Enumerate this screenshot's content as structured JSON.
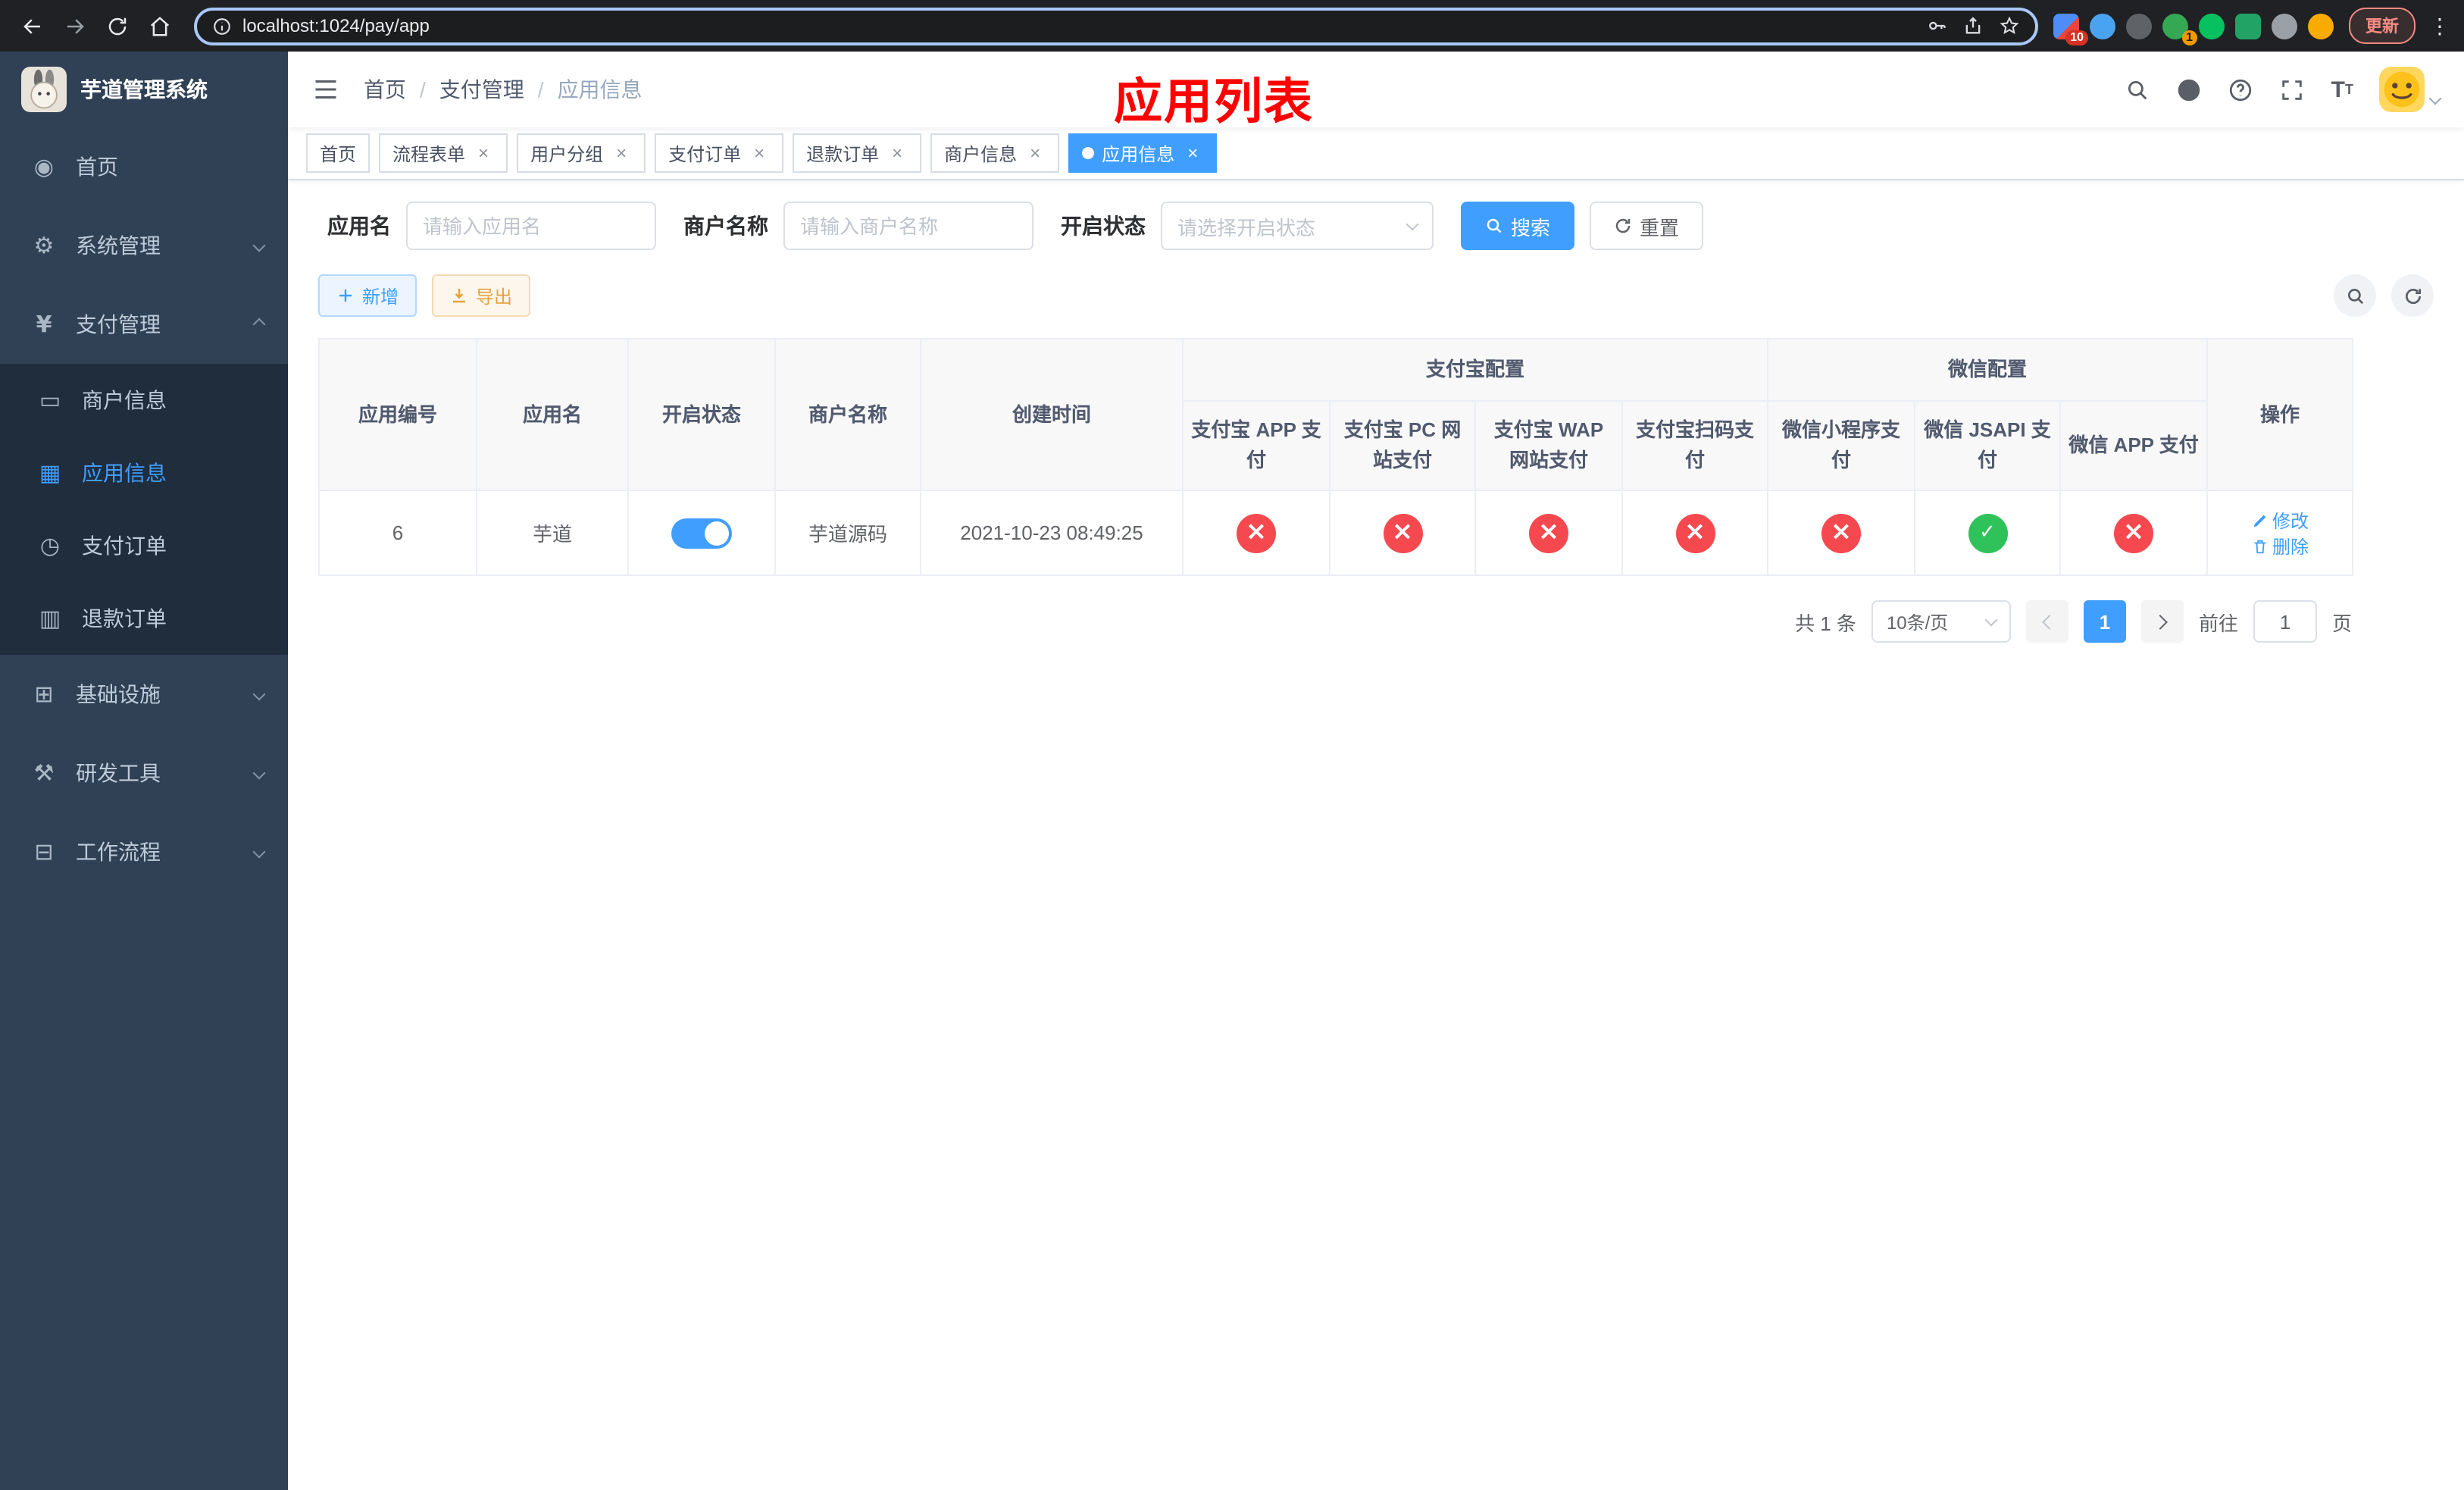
{
  "browser": {
    "url": "localhost:1024/pay/app",
    "update_label": "更新",
    "ext_badge_block": "10",
    "ext_badge_green": "1"
  },
  "sidebar": {
    "title": "芋道管理系统",
    "items": {
      "home": "首页",
      "system": "系统管理",
      "payment": "支付管理",
      "merchant_info": "商户信息",
      "app_info": "应用信息",
      "pay_order": "支付订单",
      "refund_order": "退款订单",
      "infra": "基础设施",
      "dev_tools": "研发工具",
      "workflow": "工作流程"
    }
  },
  "header": {
    "breadcrumb": [
      "首页",
      "支付管理",
      "应用信息"
    ],
    "page_title": "应用列表"
  },
  "tabs": [
    {
      "label": "首页"
    },
    {
      "label": "流程表单"
    },
    {
      "label": "用户分组"
    },
    {
      "label": "支付订单"
    },
    {
      "label": "退款订单"
    },
    {
      "label": "商户信息"
    },
    {
      "label": "应用信息"
    }
  ],
  "filters": {
    "app_name_label": "应用名",
    "app_name_placeholder": "请输入应用名",
    "merchant_label": "商户名称",
    "merchant_placeholder": "请输入商户名称",
    "status_label": "开启状态",
    "status_placeholder": "请选择开启状态",
    "search_label": "搜索",
    "reset_label": "重置"
  },
  "toolbar": {
    "add_label": "新增",
    "export_label": "导出"
  },
  "table": {
    "group_alipay": "支付宝配置",
    "group_wechat": "微信配置",
    "col_app_id": "应用编号",
    "col_app_name": "应用名",
    "col_status": "开启状态",
    "col_merchant": "商户名称",
    "col_created": "创建时间",
    "col_alipay_app": "支付宝 APP 支付",
    "col_alipay_pc": "支付宝 PC 网站支付",
    "col_alipay_wap": "支付宝 WAP 网站支付",
    "col_alipay_qr": "支付宝扫码支付",
    "col_wx_mini": "微信小程序支付",
    "col_wx_jsapi": "微信 JSAPI 支付",
    "col_wx_app": "微信 APP 支付",
    "col_actions": "操作",
    "row": {
      "id": "6",
      "name": "芋道",
      "status": "on",
      "merchant": "芋道源码",
      "created": "2021-10-23 08:49:25",
      "configs": [
        "fail",
        "fail",
        "fail",
        "fail",
        "fail",
        "ok",
        "fail"
      ],
      "edit_label": "修改",
      "delete_label": "删除"
    }
  },
  "pagination": {
    "total": "共 1 条",
    "page_size": "10条/页",
    "page": "1",
    "goto_label": "前往",
    "goto_value": "1",
    "unit_label": "页"
  },
  "colors": {
    "primary": "#409eff",
    "success": "#2fc25b",
    "danger": "#f5494f",
    "sidebar_bg": "#304156",
    "submenu_bg": "#1f2d3d",
    "annotation_red": "#ff0000"
  }
}
